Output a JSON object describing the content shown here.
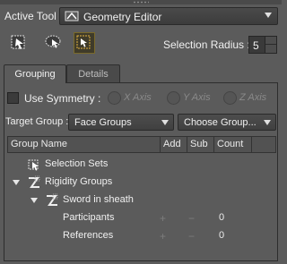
{
  "active_tool": {
    "label": "Active Tool :",
    "value": "Geometry Editor"
  },
  "selection_radius": {
    "label": "Selection Radius :",
    "value": "5"
  },
  "tabs": [
    {
      "label": "Grouping"
    },
    {
      "label": "Details"
    }
  ],
  "symmetry": {
    "label": "Use Symmetry :",
    "axes": [
      {
        "label": "X Axis"
      },
      {
        "label": "Y Axis"
      },
      {
        "label": "Z Axis"
      }
    ]
  },
  "target_group": {
    "label": "Target Group :",
    "value": "Face Groups",
    "choose": "Choose Group..."
  },
  "table": {
    "headers": {
      "name": "Group Name",
      "add": "Add",
      "sub": "Sub",
      "count": "Count"
    },
    "rows": {
      "selection_sets": "Selection Sets",
      "rigidity_groups": "Rigidity Groups",
      "sword": "Sword in sheath",
      "participants": {
        "label": "Participants",
        "plus": "+",
        "minus": "−",
        "count": "0"
      },
      "references": {
        "label": "References",
        "plus": "+",
        "minus": "−",
        "count": "0"
      }
    }
  }
}
